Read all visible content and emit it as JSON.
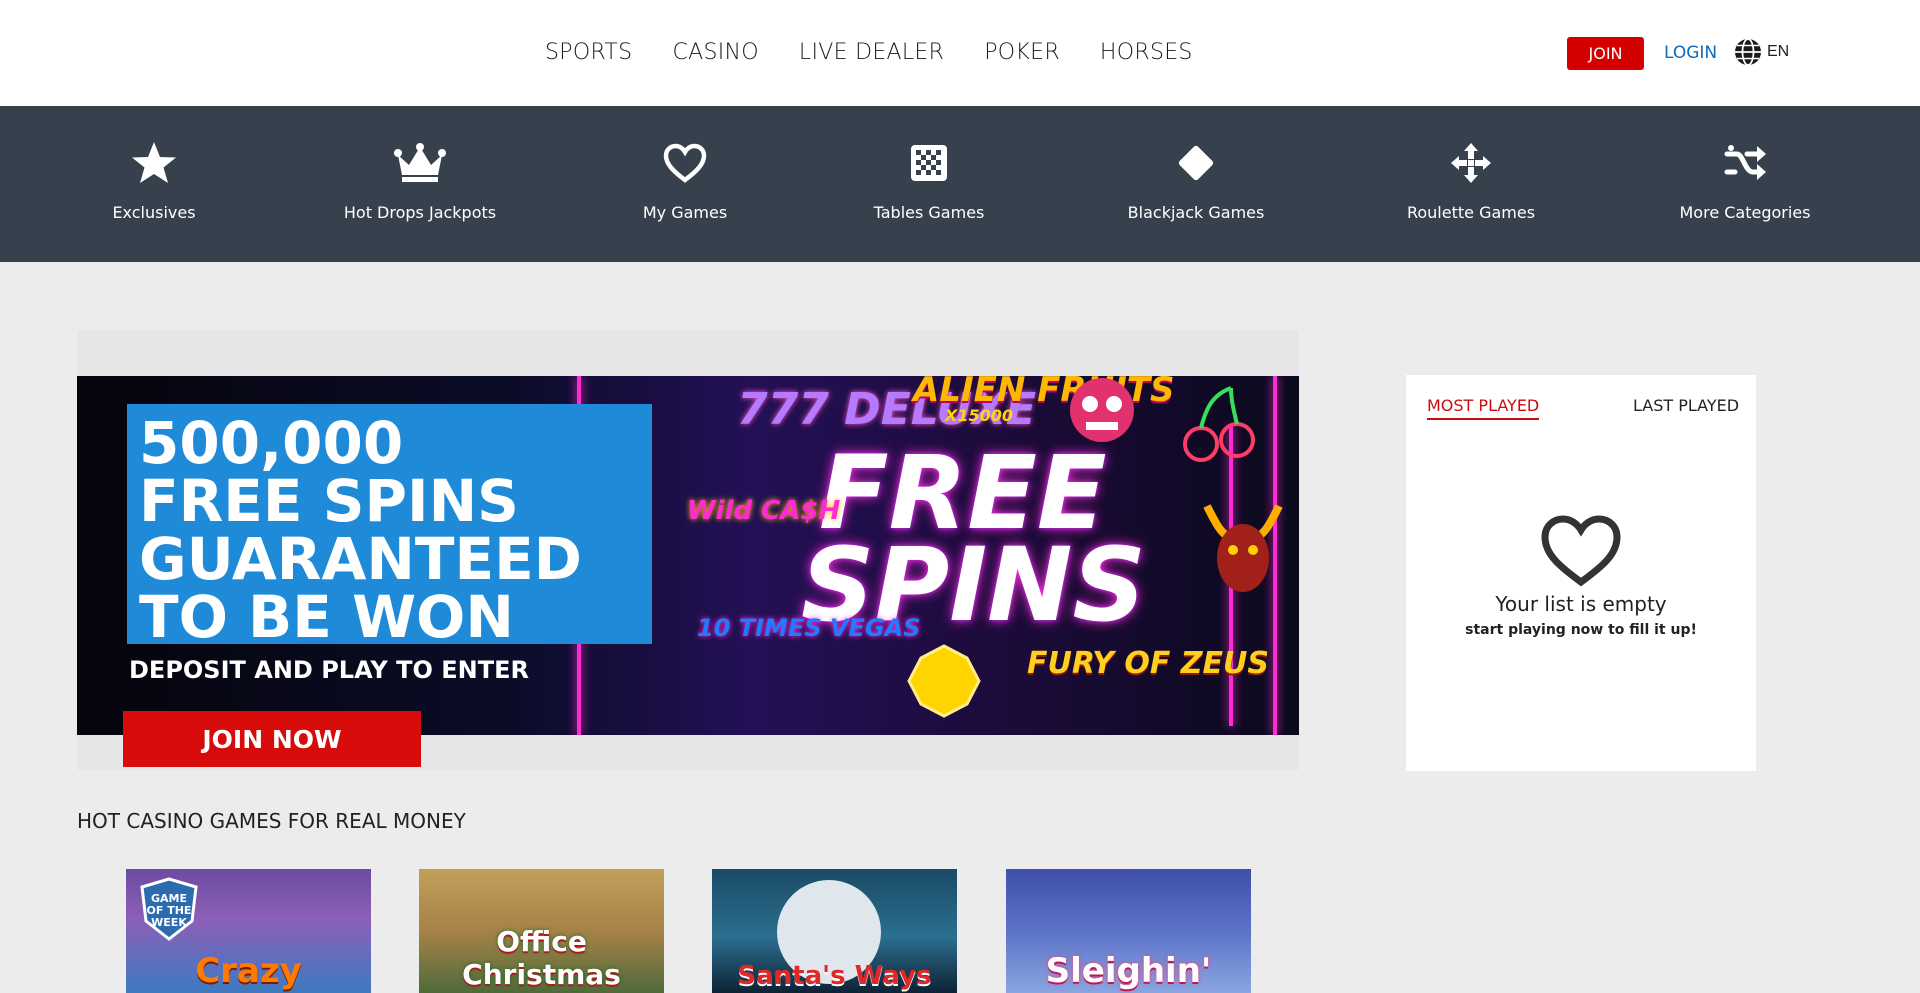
{
  "header": {
    "nav": [
      "SPORTS",
      "CASINO",
      "LIVE DEALER",
      "POKER",
      "HORSES"
    ],
    "join_label": "JOIN",
    "login_label": "LOGIN",
    "language": "EN"
  },
  "categories": [
    {
      "label": "Exclusives",
      "icon": "star-icon"
    },
    {
      "label": "Hot Drops Jackpots",
      "icon": "crown-icon"
    },
    {
      "label": "My Games",
      "icon": "heart-icon"
    },
    {
      "label": "Tables Games",
      "icon": "checkerboard-icon"
    },
    {
      "label": "Blackjack Games",
      "icon": "diamond-icon"
    },
    {
      "label": "Roulette Games",
      "icon": "arrows-icon"
    },
    {
      "label": "More Categories",
      "icon": "shuffle-icon"
    }
  ],
  "banner": {
    "headline": [
      "500,000",
      "FREE SPINS",
      "GUARANTEED",
      "TO BE WON"
    ],
    "subline": "DEPOSIT AND PLAY TO ENTER",
    "cta": "JOIN NOW",
    "big_text": [
      "FREE",
      "SPINS"
    ],
    "game_logos": [
      "777 DELUXE",
      "ALIEN FRUITS",
      "X15000",
      "Wild CA$H",
      "10 TIMES VEGAS",
      "FURY OF ZEUS"
    ]
  },
  "played_panel": {
    "tab_most": "MOST PLAYED",
    "tab_last": "LAST PLAYED",
    "empty_title": "Your list is empty",
    "empty_sub": "start playing now to fill it up!"
  },
  "hot_games": {
    "title": "HOT CASINO GAMES FOR REAL MONEY",
    "tiles": [
      {
        "name": "Crazy",
        "badge": "GAME OF THE WEEK"
      },
      {
        "name": "Office Christmas"
      },
      {
        "name": "Santa's Ways"
      },
      {
        "name": "Sleighin'"
      }
    ]
  },
  "colors": {
    "brand_red": "#d40000",
    "category_bar": "#37414d",
    "login_blue": "#0a6bbf",
    "page_bg": "#ececec"
  }
}
